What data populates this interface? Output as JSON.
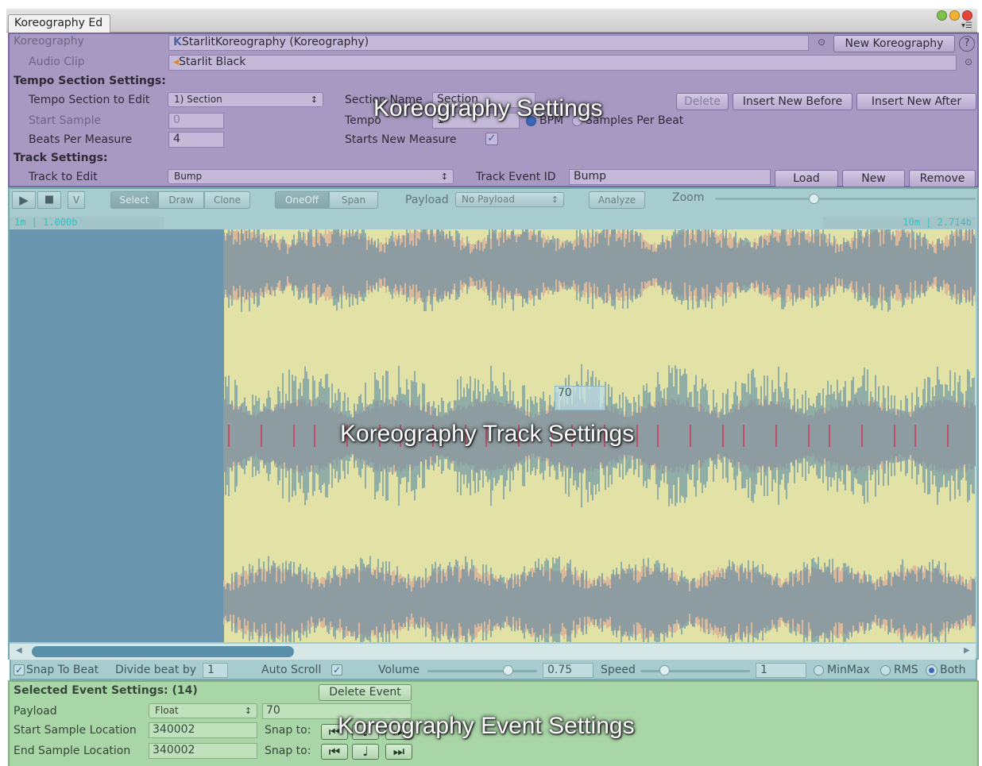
{
  "window": {
    "tab_title": "Koreography Ed",
    "menu_icon": "menu-icon"
  },
  "koreography": {
    "koreography_label": "Koreography",
    "koreography_value": "StarlitKoreography (Koreography)",
    "new_button": "New Koreography",
    "help": "?",
    "audio_clip_label": "Audio Clip",
    "audio_clip_value": "Starlit Black",
    "tempo_header": "Tempo Section Settings:",
    "tempo_edit_label": "Tempo Section to Edit",
    "tempo_edit_value": "1) Section",
    "section_name_label": "Section Name",
    "section_name_value": "Section",
    "delete_button": "Delete",
    "insert_before_button": "Insert New Before",
    "insert_after_button": "Insert New After",
    "start_sample_label": "Start Sample",
    "start_sample_value": "0",
    "tempo_label": "Tempo",
    "tempo_value": "1",
    "bpm_label": "BPM",
    "samples_per_beat_label": "Samples Per Beat",
    "beats_label": "Beats Per Measure",
    "beats_value": "4",
    "starts_measure_label": "Starts New Measure",
    "starts_measure_checked": true,
    "track_header": "Track Settings:",
    "track_edit_label": "Track to Edit",
    "track_edit_value": "Bump",
    "track_id_label": "Track Event ID",
    "track_id_value": "Bump",
    "load_button": "Load",
    "new_track_button": "New",
    "remove_button": "Remove",
    "overlay": "Koreography Settings"
  },
  "track": {
    "v_button": "V",
    "mode_buttons": [
      "Select",
      "Draw",
      "Clone"
    ],
    "span_buttons": [
      "OneOff",
      "Span"
    ],
    "payload_label": "Payload",
    "payload_value": "No Payload",
    "analyze_button": "Analyze",
    "zoom_label": "Zoom",
    "ruler_left": "1m | 1.000b",
    "ruler_right": "10m | 2.714b",
    "event_value": "70",
    "overlay": "Koreography Track Settings",
    "colors": {
      "waveform": "#5b8ba6",
      "rms": "#dcb89a",
      "background": "#e2e1a6",
      "event_marker": "#c0506a"
    }
  },
  "controls": {
    "snap_label": "Snap To Beat",
    "snap_checked": true,
    "divide_label": "Divide beat by",
    "divide_value": "1",
    "autoscroll_label": "Auto Scroll",
    "autoscroll_checked": true,
    "volume_label": "Volume",
    "volume_value": "0.75",
    "speed_label": "Speed",
    "speed_value": "1",
    "radio_options": [
      "MinMax",
      "RMS",
      "Both"
    ],
    "radio_selected": "Both"
  },
  "event": {
    "header": "Selected Event Settings: (14)",
    "delete_button": "Delete Event",
    "payload_label": "Payload",
    "payload_type": "Float",
    "payload_value": "70",
    "start_label": "Start Sample Location",
    "start_value": "340002",
    "end_label": "End Sample Location",
    "end_value": "340002",
    "snap_label": "Snap to:",
    "overlay": "Koreography Event Settings"
  }
}
